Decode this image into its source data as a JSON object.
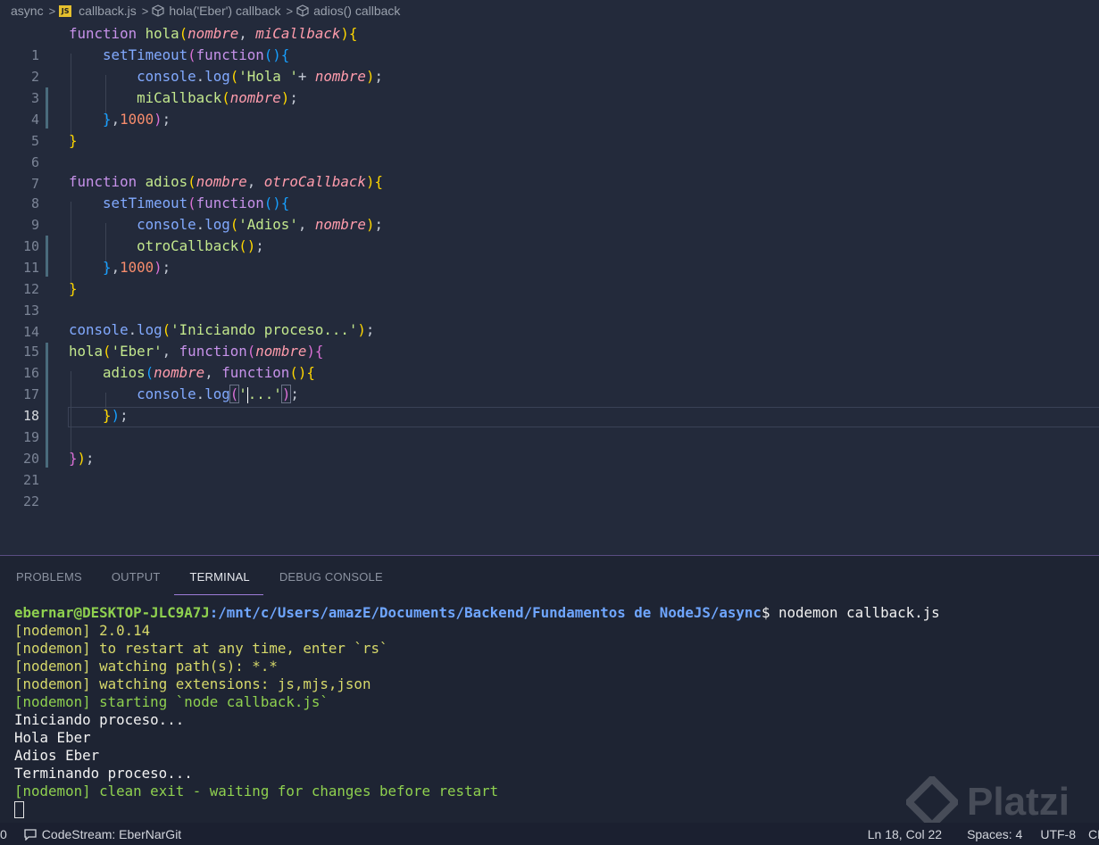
{
  "breadcrumb": {
    "folder": "async",
    "file": "callback.js",
    "file_badge": "JS",
    "symbol1": "hola('Eber') callback",
    "symbol2": "adios() callback"
  },
  "editor": {
    "active_line": 18,
    "lines": [
      {
        "n": "1"
      },
      {
        "n": "2"
      },
      {
        "n": "3"
      },
      {
        "n": "4"
      },
      {
        "n": "5"
      },
      {
        "n": "6"
      },
      {
        "n": "7"
      },
      {
        "n": "8"
      },
      {
        "n": "9"
      },
      {
        "n": "10"
      },
      {
        "n": "11"
      },
      {
        "n": "12"
      },
      {
        "n": "13"
      },
      {
        "n": "14"
      },
      {
        "n": "15"
      },
      {
        "n": "16"
      },
      {
        "n": "17"
      },
      {
        "n": "18"
      },
      {
        "n": "19"
      },
      {
        "n": "20"
      },
      {
        "n": "21"
      },
      {
        "n": "22"
      }
    ],
    "code": {
      "l1": [
        "function",
        "hola",
        "(",
        "nombre",
        ", ",
        "miCallback",
        ")",
        "{"
      ],
      "l2": [
        "setTimeout",
        "(",
        "function",
        "()",
        "{"
      ],
      "l3": [
        "console",
        ".",
        "log",
        "(",
        "'Hola '",
        "+ ",
        "nombre",
        ")",
        ";"
      ],
      "l4": [
        "miCallback",
        "(",
        "nombre",
        ")",
        ";"
      ],
      "l5": [
        "}",
        ",",
        "1000",
        ")",
        ";"
      ],
      "l6": [
        "}"
      ],
      "l8": [
        "function",
        "adios",
        "(",
        "nombre",
        ", ",
        "otroCallback",
        ")",
        "{"
      ],
      "l9": [
        "setTimeout",
        "(",
        "function",
        "()",
        "{"
      ],
      "l10": [
        "console",
        ".",
        "log",
        "(",
        "'Adios'",
        ", ",
        "nombre",
        ")",
        ";"
      ],
      "l11": [
        "otroCallback",
        "(",
        ")",
        ";"
      ],
      "l12": [
        "}",
        ",",
        "1000",
        ")",
        ";"
      ],
      "l13": [
        "}"
      ],
      "l15": [
        "console",
        ".",
        "log",
        "(",
        "'Iniciando proceso...'",
        ")",
        ";"
      ],
      "l16": [
        "hola",
        "(",
        "'Eber'",
        ", ",
        "function",
        "(",
        "nombre",
        ")",
        "{"
      ],
      "l17": [
        "adios",
        "(",
        "nombre",
        ", ",
        "function",
        "()",
        "{"
      ],
      "l18": [
        "console",
        ".",
        "log",
        "(",
        "'",
        "...'",
        ")",
        ";"
      ],
      "l19": [
        "}",
        ")",
        ";"
      ],
      "l21": [
        "}",
        ")",
        ";"
      ]
    }
  },
  "panel": {
    "tabs": [
      "PROBLEMS",
      "OUTPUT",
      "TERMINAL",
      "DEBUG CONSOLE"
    ],
    "active_tab": "TERMINAL",
    "terminal": {
      "prompt_user": "ebernar@DESKTOP-JLC9A7J",
      "prompt_path": ":/mnt/c/Users/amazE/Documents/Backend/Fundamentos de NodeJS/async",
      "prompt_symbol": "$ ",
      "command": "nodemon callback.js",
      "lines": [
        {
          "tag": "[nodemon]",
          "text": " 2.0.14"
        },
        {
          "tag": "[nodemon]",
          "text": " to restart at any time, enter `rs`"
        },
        {
          "tag": "[nodemon]",
          "text": " watching path(s): *.*"
        },
        {
          "tag": "[nodemon]",
          "text": " watching extensions: js,mjs,json"
        },
        {
          "tag": "[nodemon]",
          "text": " starting `node callback.js`"
        }
      ],
      "output": [
        "Iniciando proceso...",
        "Hola Eber",
        "Adios Eber",
        "Terminando proceso..."
      ],
      "final": {
        "tag": "[nodemon]",
        "text": " clean exit - waiting for changes before restart"
      }
    }
  },
  "status_bar": {
    "left_edge": "0",
    "codestream": "CodeStream: EberNarGit",
    "position": "Ln 18, Col 22",
    "spaces": "Spaces: 4",
    "encoding": "UTF-8",
    "cut": "CR"
  },
  "watermark": {
    "text": "Platzi"
  },
  "colors": {
    "background": "#232a3b",
    "panel": "#1e2433",
    "keyword": "#c792ea",
    "function": "#82aaff",
    "string": "#c3e88d",
    "parameter": "#ff9cac",
    "number": "#f78c6c",
    "terminal_green": "#8fd14f",
    "terminal_yellow": "#d7d96a"
  }
}
